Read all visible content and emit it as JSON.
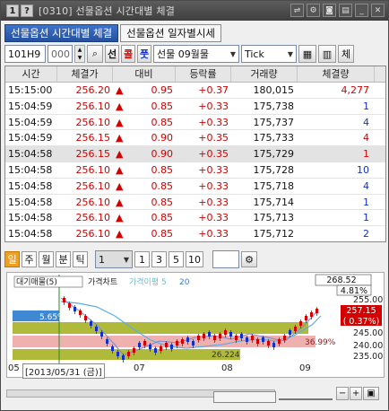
{
  "window": {
    "badge": "1",
    "help": "?",
    "title": "[0310] 선물옵션 시간대별 체결"
  },
  "tabs": [
    {
      "label": "선물옵션 시간대별 체결"
    },
    {
      "label": "선물옵션 일자별시세"
    }
  ],
  "toolbar": {
    "code": "101H9",
    "sub_code": "000",
    "btn_seon": "선",
    "btn_kol": "콜",
    "btn_put": "풋",
    "product_select": "선물 09월물",
    "tick_select": "Tick",
    "btn_che": "체"
  },
  "grid": {
    "headers": [
      "시간",
      "체결가",
      "대비",
      "등락률",
      "거래량",
      "체결량"
    ],
    "rows": [
      {
        "time": "15:15:00",
        "price": "256.20",
        "arrow": "▲",
        "diff": "0.95",
        "rate": "+0.37",
        "volume": "180,015",
        "qty": "4,277",
        "qcolor": "red"
      },
      {
        "time": "15:04:59",
        "price": "256.10",
        "arrow": "▲",
        "diff": "0.85",
        "rate": "+0.33",
        "volume": "175,738",
        "qty": "1",
        "qcolor": "blue"
      },
      {
        "time": "15:04:59",
        "price": "256.10",
        "arrow": "▲",
        "diff": "0.85",
        "rate": "+0.33",
        "volume": "175,737",
        "qty": "4",
        "qcolor": "blue"
      },
      {
        "time": "15:04:59",
        "price": "256.15",
        "arrow": "▲",
        "diff": "0.90",
        "rate": "+0.35",
        "volume": "175,733",
        "qty": "4",
        "qcolor": "red"
      },
      {
        "time": "15:04:58",
        "price": "256.15",
        "arrow": "▲",
        "diff": "0.90",
        "rate": "+0.35",
        "volume": "175,729",
        "qty": "1",
        "qcolor": "red"
      },
      {
        "time": "15:04:58",
        "price": "256.10",
        "arrow": "▲",
        "diff": "0.85",
        "rate": "+0.33",
        "volume": "175,728",
        "qty": "10",
        "qcolor": "blue"
      },
      {
        "time": "15:04:58",
        "price": "256.10",
        "arrow": "▲",
        "diff": "0.85",
        "rate": "+0.33",
        "volume": "175,718",
        "qty": "4",
        "qcolor": "blue"
      },
      {
        "time": "15:04:58",
        "price": "256.10",
        "arrow": "▲",
        "diff": "0.85",
        "rate": "+0.33",
        "volume": "175,714",
        "qty": "1",
        "qcolor": "blue"
      },
      {
        "time": "15:04:58",
        "price": "256.10",
        "arrow": "▲",
        "diff": "0.85",
        "rate": "+0.33",
        "volume": "175,713",
        "qty": "1",
        "qcolor": "blue"
      },
      {
        "time": "15:04:58",
        "price": "256.10",
        "arrow": "▲",
        "diff": "0.85",
        "rate": "+0.33",
        "volume": "175,712",
        "qty": "2",
        "qcolor": "blue"
      }
    ]
  },
  "chart_toolbar": {
    "periods": [
      "일",
      "주",
      "월",
      "분",
      "틱"
    ],
    "select_value": "1",
    "intervals": [
      "1",
      "3",
      "5",
      "10"
    ]
  },
  "chart": {
    "legend_items": [
      "대기매물(5)",
      "가격차트",
      "가격이평 5",
      "20"
    ],
    "price_labels": [
      "268.52",
      "4.81%",
      "255.00",
      "257.15",
      "( 0.37%)",
      "245.00",
      "240.00",
      "235.00"
    ],
    "volume_profile": [
      "5.65%",
      "36.99%",
      "26.224"
    ],
    "x_labels": [
      "05",
      "[2013/05/31 (금)]",
      "07",
      "08",
      "09"
    ]
  },
  "colors": {
    "accent": "#2a5bb5",
    "up": "#d40000",
    "down": "#1030c8"
  }
}
